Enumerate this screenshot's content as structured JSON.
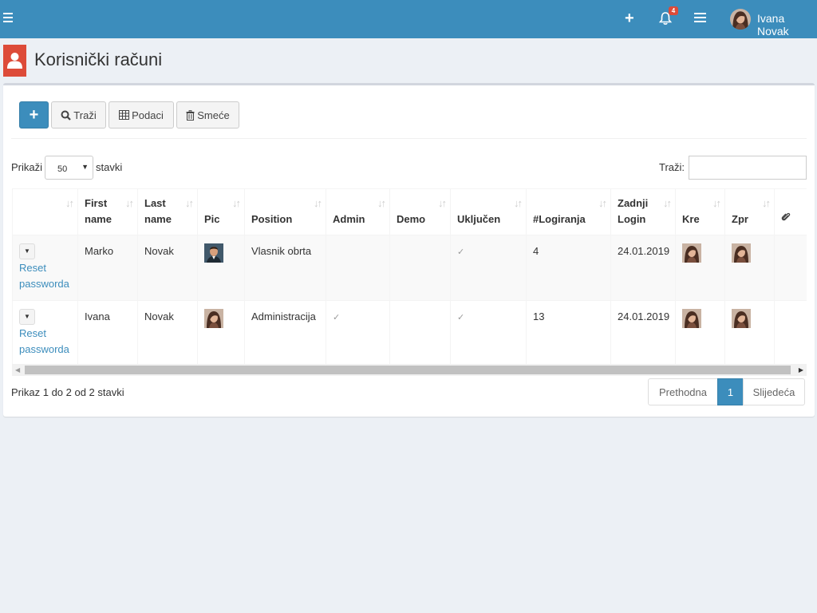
{
  "header": {
    "user_name": "Ivana Novak",
    "notifications_count": "4",
    "add_label": "+",
    "color": "#3c8dbc"
  },
  "page": {
    "title": "Korisnički računi",
    "icon": "user-icon"
  },
  "toolbar": {
    "add_label": "+",
    "search_label": "Traži",
    "data_label": "Podaci",
    "trash_label": "Smeće"
  },
  "length": {
    "prefix": "Prikaži",
    "value": "50",
    "suffix": "stavki"
  },
  "filter": {
    "label": "Traži:",
    "value": ""
  },
  "table": {
    "headers": [
      "",
      "First name",
      "Last name",
      "Pic",
      "Position",
      "Admin",
      "Demo",
      "Uključen",
      "#Logiranja",
      "Zadnji Login",
      "Kre",
      "Zpr",
      ""
    ],
    "rows": [
      {
        "action": "Reset passworda",
        "first_name": "Marko",
        "last_name": "Novak",
        "pic": "male-avatar",
        "position": "Vlasnik obrta",
        "admin": "",
        "demo": "",
        "ukljucen": "✓",
        "logins": "4",
        "last_login": "24.01.2019"
      },
      {
        "action": "Reset passworda",
        "first_name": "Ivana",
        "last_name": "Novak",
        "pic": "female-avatar",
        "position": "Administracija",
        "admin": "✓",
        "demo": "",
        "ukljucen": "✓",
        "logins": "13",
        "last_login": "24.01.2019"
      }
    ]
  },
  "footer": {
    "info": "Prikaz 1 do 2 od 2 stavki",
    "prev": "Prethodna",
    "current": "1",
    "next": "Slijedeća"
  }
}
